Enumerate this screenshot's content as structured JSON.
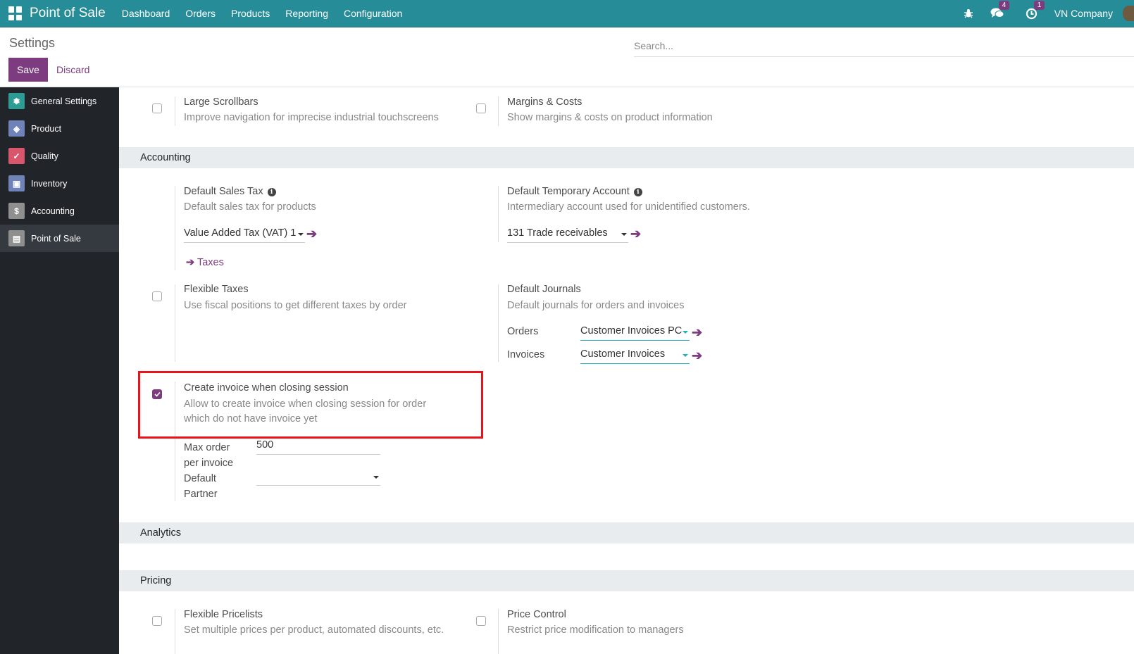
{
  "navbar": {
    "app_name": "Point of Sale",
    "menu": [
      "Dashboard",
      "Orders",
      "Products",
      "Reporting",
      "Configuration"
    ],
    "messages_count": "4",
    "activities_count": "1",
    "company": "VN Company",
    "colors": {
      "navbar_bg": "#268c97",
      "accent": "#7c3c7f"
    }
  },
  "control_panel": {
    "title": "Settings",
    "save_label": "Save",
    "discard_label": "Discard",
    "search_placeholder": "Search..."
  },
  "sidebar": {
    "items": [
      {
        "label": "General Settings",
        "icon": "gear-icon",
        "color": "#2c9c94"
      },
      {
        "label": "Product",
        "icon": "tags-icon",
        "color": "#6f83b8"
      },
      {
        "label": "Quality",
        "icon": "check-badge-icon",
        "color": "#d9566d"
      },
      {
        "label": "Inventory",
        "icon": "box-icon",
        "color": "#6f83b8"
      },
      {
        "label": "Accounting",
        "icon": "invoice-icon",
        "color": "#8f8f8f"
      },
      {
        "label": "Point of Sale",
        "icon": "pos-icon",
        "color": "#8f8f8f",
        "active": true
      }
    ]
  },
  "settings": {
    "large_scrollbars": {
      "title": "Large Scrollbars",
      "desc": "Improve navigation for imprecise industrial touchscreens",
      "checked": false
    },
    "margins_costs": {
      "title": "Margins & Costs",
      "desc": "Show margins & costs on product information",
      "checked": false
    },
    "accounting_header": "Accounting",
    "default_sales_tax": {
      "title": "Default Sales Tax",
      "desc": "Default sales tax for products",
      "value": "Value Added Tax (VAT) 1",
      "link": "Taxes"
    },
    "default_temp_account": {
      "title": "Default Temporary Account",
      "desc": "Intermediary account used for unidentified customers.",
      "value": "131 Trade receivables"
    },
    "flexible_taxes": {
      "title": "Flexible Taxes",
      "desc": "Use fiscal positions to get different taxes by order",
      "checked": false
    },
    "default_journals": {
      "title": "Default Journals",
      "desc": "Default journals for orders and invoices",
      "orders_label": "Orders",
      "orders_value": "Customer Invoices PC",
      "invoices_label": "Invoices",
      "invoices_value": "Customer Invoices"
    },
    "create_invoice": {
      "title": "Create invoice when closing session",
      "desc_line1": "Allow to create invoice when closing session for order",
      "desc_line2": "which do not have invoice yet",
      "checked": true,
      "max_order_label_1": "Max order",
      "max_order_label_2": "per invoice",
      "max_order_value": "500",
      "default_partner_label_1": "Default",
      "default_partner_label_2": "Partner",
      "default_partner_value": ""
    },
    "analytics_header": "Analytics",
    "pricing_header": "Pricing",
    "flexible_pricelists": {
      "title": "Flexible Pricelists",
      "desc": "Set multiple prices per product, automated discounts, etc.",
      "checked": false
    },
    "price_control": {
      "title": "Price Control",
      "desc": "Restrict price modification to managers",
      "checked": false
    }
  }
}
